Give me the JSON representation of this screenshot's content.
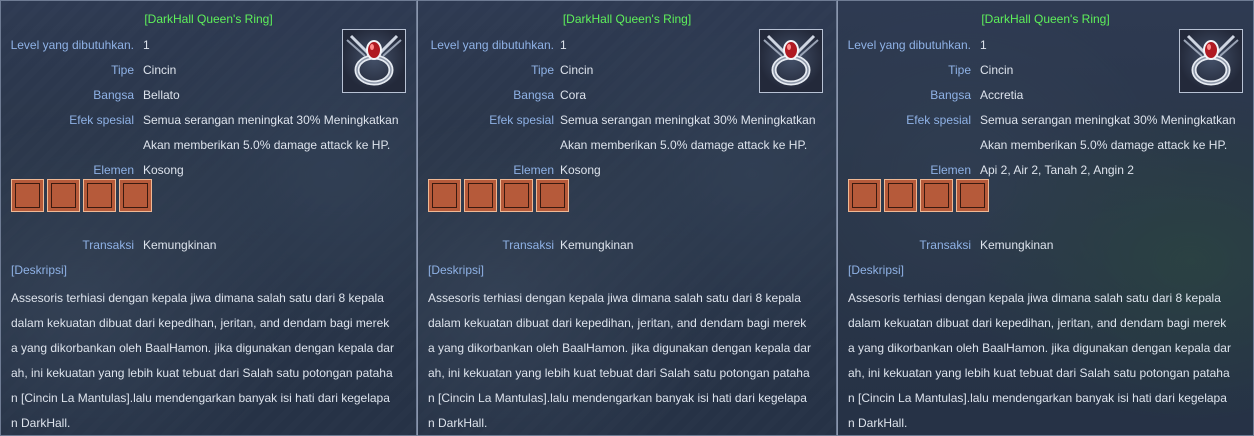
{
  "panels": [
    {
      "title": "[DarkHall Queen's Ring]",
      "labels": {
        "level": "Level yang dibutuhkan.",
        "type": "Tipe",
        "race": "Bangsa",
        "effect": "Efek spesial",
        "element": "Elemen",
        "trade": "Transaksi",
        "desc": "[Deskripsi]"
      },
      "level": "1",
      "type": "Cincin",
      "race": "Bellato",
      "effect_line1": "Semua serangan meningkat 30% Meningkatkan",
      "effect_line2": "Akan memberikan 5.0% damage attack ke HP.",
      "element": "Kosong",
      "trade": "Kemungkinan",
      "description_lines": [
        "Assesoris terhiasi dengan kepala jiwa dimana salah satu dari 8 kepala",
        "dalam kekuatan dibuat dari kepedihan, jeritan, and dendam bagi merek",
        "a yang dikorbankan oleh BaalHamon. jika digunakan dengan kepala dar",
        "ah, ini kekuatan yang lebih kuat tebuat dari Salah satu potongan pataha",
        "n [Cincin La Mantulas].lalu mendengarkan  banyak isi hati dari kegelapa",
        "n DarkHall."
      ],
      "slot_icons": [
        "twig-icon",
        "twig-icon",
        "ring-icon",
        "ring-icon"
      ]
    },
    {
      "title": "[DarkHall Queen's Ring]",
      "labels": {
        "level": "Level yang dibutuhkan.",
        "type": "Tipe",
        "race": "Bangsa",
        "effect": "Efek spesial",
        "element": "Elemen",
        "trade": "Transaksi",
        "desc": "[Deskripsi]"
      },
      "level": "1",
      "type": "Cincin",
      "race": "Cora",
      "effect_line1": "Semua serangan meningkat 30% Meningkatkan",
      "effect_line2": "Akan memberikan 5.0% damage attack ke HP.",
      "element": "Kosong",
      "trade": "Kemungkinan",
      "description_lines": [
        "Assesoris terhiasi dengan kepala jiwa dimana salah satu dari 8 kepala",
        "dalam kekuatan dibuat dari kepedihan, jeritan, and dendam bagi merek",
        "a yang dikorbankan oleh BaalHamon. jika digunakan dengan kepala dar",
        "ah, ini kekuatan yang lebih kuat tebuat dari Salah satu potongan pataha",
        "n [Cincin La Mantulas].lalu mendengarkan  banyak isi hati dari kegelapa",
        "n DarkHall."
      ],
      "slot_icons": [
        "twig-icon",
        "twig-icon",
        "ring-icon",
        "ring-icon"
      ]
    },
    {
      "title": "[DarkHall Queen's Ring]",
      "labels": {
        "level": "Level yang dibutuhkan.",
        "type": "Tipe",
        "race": "Bangsa",
        "effect": "Efek spesial",
        "element": "Elemen",
        "trade": "Transaksi",
        "desc": "[Deskripsi]"
      },
      "level": "1",
      "type": "Cincin",
      "race": "Accretia",
      "effect_line1": "Semua serangan meningkat 30% Meningkatkan",
      "effect_line2": "Akan memberikan 5.0% damage attack ke HP.",
      "element": "Api 2, Air 2, Tanah 2, Angin 2",
      "trade": "Kemungkinan",
      "description_lines": [
        "Assesoris terhiasi dengan kepala jiwa dimana salah satu dari 8 kepala",
        "dalam kekuatan dibuat dari kepedihan, jeritan, and dendam bagi merek",
        "a yang dikorbankan oleh BaalHamon. jika digunakan dengan kepala dar",
        "ah, ini kekuatan yang lebih kuat tebuat dari Salah satu potongan pataha",
        "n [Cincin La Mantulas].lalu mendengarkan  banyak isi hati dari kegelapa",
        "n DarkHall."
      ],
      "slot_icons": [
        "twig-icon",
        "twig-icon",
        "ring-icon",
        "ring-icon"
      ]
    }
  ],
  "colors": {
    "title": "#5ef05a",
    "label": "#8fb2e6",
    "value": "#dde3ec",
    "slot": "#b65a3a"
  }
}
